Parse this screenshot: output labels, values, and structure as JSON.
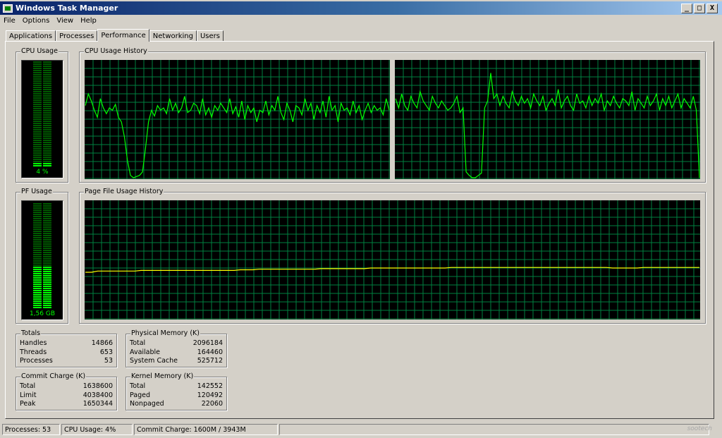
{
  "window": {
    "title": "Windows Task Manager",
    "min_label": "_",
    "max_label": "□",
    "close_label": "X"
  },
  "menu": [
    "File",
    "Options",
    "View",
    "Help"
  ],
  "tabs": [
    {
      "label": "Applications",
      "active": false
    },
    {
      "label": "Processes",
      "active": false
    },
    {
      "label": "Performance",
      "active": true
    },
    {
      "label": "Networking",
      "active": false
    },
    {
      "label": "Users",
      "active": false
    }
  ],
  "cpu_usage": {
    "label": "CPU Usage",
    "value": "4 %",
    "fraction": 0.04
  },
  "cpu_history": {
    "label": "CPU Usage History",
    "cpu0": [
      62,
      72,
      66,
      58,
      52,
      68,
      60,
      55,
      60,
      58,
      63,
      52,
      48,
      35,
      15,
      2,
      0,
      1,
      2,
      5,
      25,
      48,
      58,
      53,
      62,
      58,
      60,
      55,
      68,
      58,
      64,
      56,
      60,
      70,
      56,
      58,
      64,
      62,
      55,
      68,
      54,
      60,
      52,
      62,
      58,
      64,
      60,
      56,
      68,
      55,
      61,
      52,
      66,
      50,
      62,
      56,
      60,
      48,
      58,
      56,
      66,
      54,
      62,
      58,
      70,
      56,
      50,
      64,
      58,
      48,
      62,
      60,
      54,
      68,
      58,
      64,
      50,
      62,
      56,
      66,
      52,
      70,
      58,
      62,
      48,
      64,
      58,
      60,
      54,
      66,
      56,
      62,
      50,
      58,
      64,
      56,
      62,
      58,
      60,
      54,
      68,
      58
    ],
    "cpu1": [
      68,
      60,
      72,
      62,
      58,
      70,
      64,
      60,
      74,
      66,
      62,
      58,
      70,
      64,
      60,
      66,
      62,
      58,
      60,
      64,
      70,
      56,
      60,
      5,
      2,
      0,
      0,
      2,
      4,
      60,
      66,
      90,
      68,
      72,
      62,
      70,
      64,
      60,
      74,
      66,
      62,
      70,
      64,
      68,
      60,
      72,
      66,
      62,
      70,
      58,
      64,
      68,
      62,
      76,
      60,
      66,
      70,
      62,
      58,
      72,
      64,
      66,
      60,
      70,
      62,
      68,
      64,
      72,
      58,
      66,
      62,
      70,
      64,
      60,
      68,
      66,
      62,
      74,
      58,
      68,
      64,
      60,
      70,
      62,
      66,
      72,
      58,
      68,
      62,
      70,
      60,
      66,
      72,
      60,
      68,
      64,
      60,
      70,
      58,
      0
    ]
  },
  "pf_usage": {
    "label": "PF Usage",
    "value": "1,56 GB",
    "fraction": 0.4
  },
  "pf_history": {
    "label": "Page File Usage History",
    "values": [
      39.4,
      39.4,
      40.4,
      40.4,
      40.4,
      40.4,
      40.4,
      40.4,
      40.4,
      41.0,
      41.0,
      41.0,
      41.0,
      41.0,
      41.0,
      41.0,
      41.0,
      41.0,
      41.0,
      41.0,
      41.0,
      41.0,
      41.0,
      41.0,
      41.0,
      41.5,
      41.5,
      41.5,
      42.0,
      42.0,
      42.0,
      42.0,
      42.0,
      42.0,
      42.0,
      42.0,
      42.0,
      42.0,
      42.5,
      42.5,
      42.5,
      42.5,
      42.5,
      42.5,
      42.5,
      42.5,
      43.0,
      43.0,
      43.0,
      43.0,
      43.0,
      43.0,
      43.0,
      43.0,
      43.0,
      43.0,
      43.0,
      43.0,
      43.0,
      43.5,
      43.5,
      43.5,
      43.5,
      43.5,
      43.5,
      43.5,
      43.5,
      43.5,
      43.5,
      43.5,
      43.5,
      43.5,
      43.5,
      43.5,
      43.5,
      43.5,
      43.5,
      43.5,
      43.5,
      43.5,
      43.5,
      43.5,
      43.5,
      43.5,
      43.5,
      43.0,
      43.0,
      43.0,
      43.0,
      43.0,
      43.5,
      43.5,
      43.5,
      43.5,
      43.5,
      43.5,
      43.5,
      43.5,
      43.5,
      43.5
    ]
  },
  "totals": {
    "label": "Totals",
    "rows": [
      {
        "name": "Handles",
        "value": "14866"
      },
      {
        "name": "Threads",
        "value": "653"
      },
      {
        "name": "Processes",
        "value": "53"
      }
    ]
  },
  "physical_memory": {
    "label": "Physical Memory (K)",
    "rows": [
      {
        "name": "Total",
        "value": "2096184"
      },
      {
        "name": "Available",
        "value": "164460"
      },
      {
        "name": "System Cache",
        "value": "525712"
      }
    ]
  },
  "commit_charge": {
    "label": "Commit Charge (K)",
    "rows": [
      {
        "name": "Total",
        "value": "1638600"
      },
      {
        "name": "Limit",
        "value": "4038400"
      },
      {
        "name": "Peak",
        "value": "1650344"
      }
    ]
  },
  "kernel_memory": {
    "label": "Kernel Memory (K)",
    "rows": [
      {
        "name": "Total",
        "value": "142552"
      },
      {
        "name": "Paged",
        "value": "120492"
      },
      {
        "name": "Nonpaged",
        "value": "22060"
      }
    ]
  },
  "status": {
    "processes": "Processes: 53",
    "cpu": "CPU Usage: 4%",
    "commit": "Commit Charge: 1600M / 3943M"
  },
  "watermark": "sootech",
  "colors": {
    "grid": "#008040",
    "cpu_line": "#00ff00",
    "pf_line": "#ffff00",
    "meter_on": "#00ff00",
    "meter_off": "#005a00"
  }
}
